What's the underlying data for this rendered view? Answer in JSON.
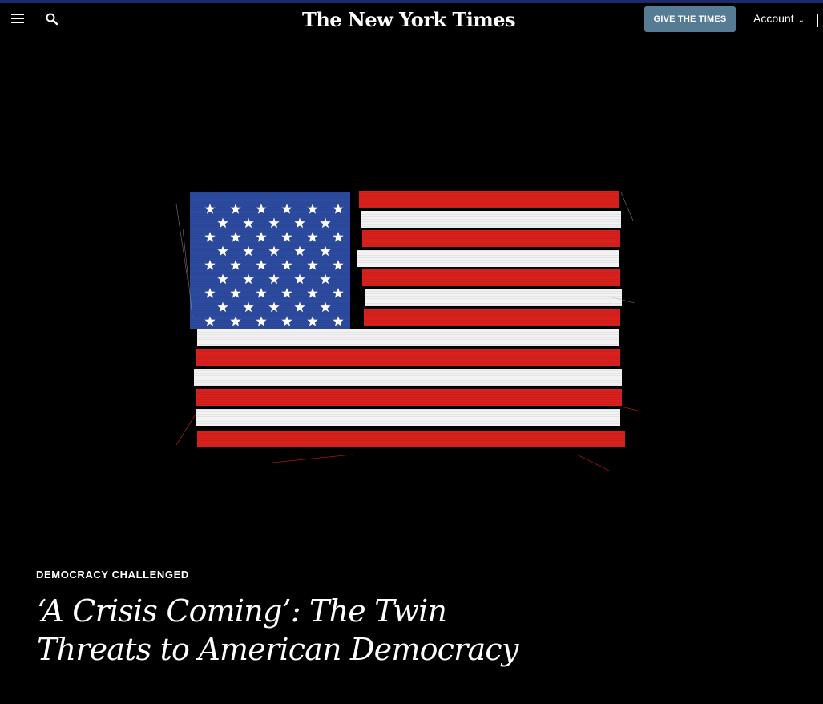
{
  "header": {
    "logo": "The New York Times",
    "give_button": "GIVE THE TIMES",
    "account_label": "Account"
  },
  "article": {
    "kicker": "DEMOCRACY CHALLENGED",
    "headline": "‘A Crisis Coming’: The Twin Threats to American Democracy"
  },
  "colors": {
    "background": "#000000",
    "button": "#567b95",
    "flag_red": "#d8201c",
    "flag_white": "#f2f2f2",
    "flag_blue": "#2c4a9e"
  },
  "icons": [
    "hamburger-menu-icon",
    "search-icon",
    "chevron-down-icon"
  ]
}
